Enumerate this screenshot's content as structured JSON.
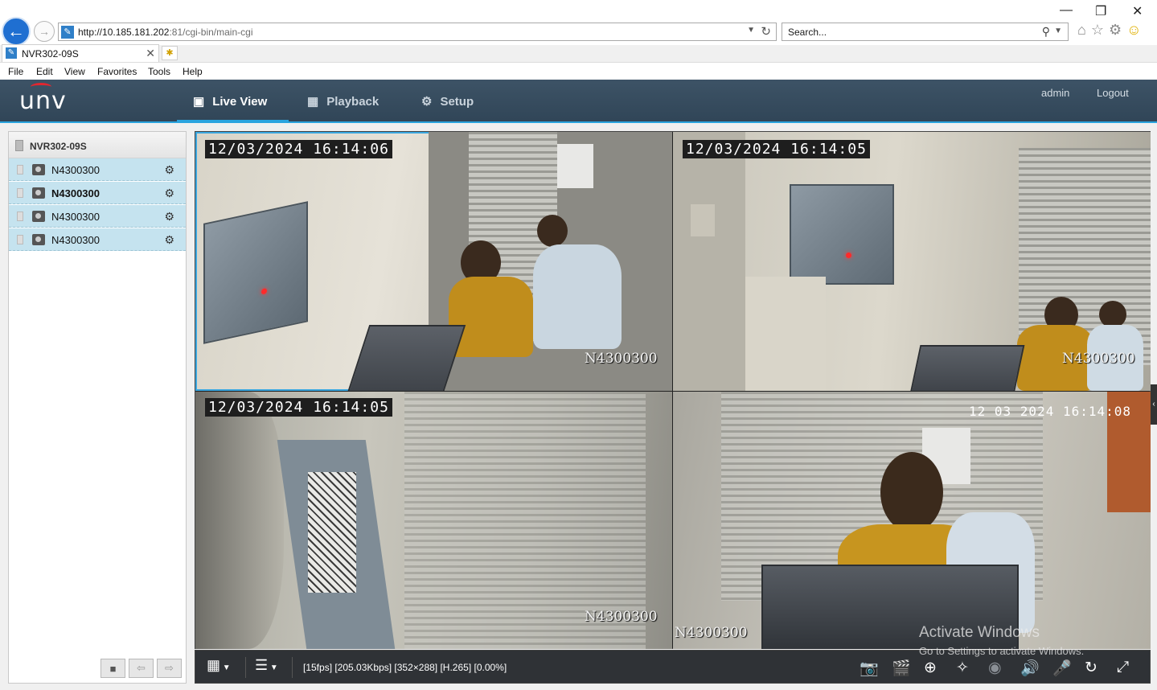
{
  "browser": {
    "url_host": "http://10.185.181.202",
    "url_rest": ":81/cgi-bin/main-cgi",
    "search_placeholder": "Search...",
    "tab_title": "NVR302-09S",
    "menu": [
      "File",
      "Edit",
      "View",
      "Favorites",
      "Tools",
      "Help"
    ]
  },
  "app": {
    "logo": "unv",
    "nav": [
      {
        "label": "Live View",
        "icon": "monitor-icon",
        "active": true
      },
      {
        "label": "Playback",
        "icon": "film-icon",
        "active": false
      },
      {
        "label": "Setup",
        "icon": "gear-icon",
        "active": false
      }
    ],
    "user": "admin",
    "logout": "Logout"
  },
  "sidebar": {
    "device": "NVR302-09S",
    "cameras": [
      {
        "name": "N4300300",
        "bold": false
      },
      {
        "name": "N4300300",
        "bold": true
      },
      {
        "name": "N4300300",
        "bold": false
      },
      {
        "name": "N4300300",
        "bold": false
      }
    ]
  },
  "tiles": [
    {
      "timestamp": "12/03/2024 16:14:06",
      "camera": "N4300300"
    },
    {
      "timestamp": "12/03/2024 16:14:05",
      "camera": "N4300300"
    },
    {
      "timestamp": "12/03/2024 16:14:05",
      "camera": "N4300300"
    },
    {
      "timestamp": "12 03 2024 16:14:08",
      "camera": "N4300300"
    }
  ],
  "toolbar": {
    "stream_info": "[15fps] [205.03Kbps] [352×288] [H.265] [0.00%]"
  },
  "watermark": {
    "line1": "Activate Windows",
    "line2": "Go to Settings to activate Windows."
  },
  "colors": {
    "header_bg": "#304557",
    "accent": "#2aa4df",
    "camera_row": "#c5e3ef",
    "toolbar_bg": "#2f3236"
  }
}
